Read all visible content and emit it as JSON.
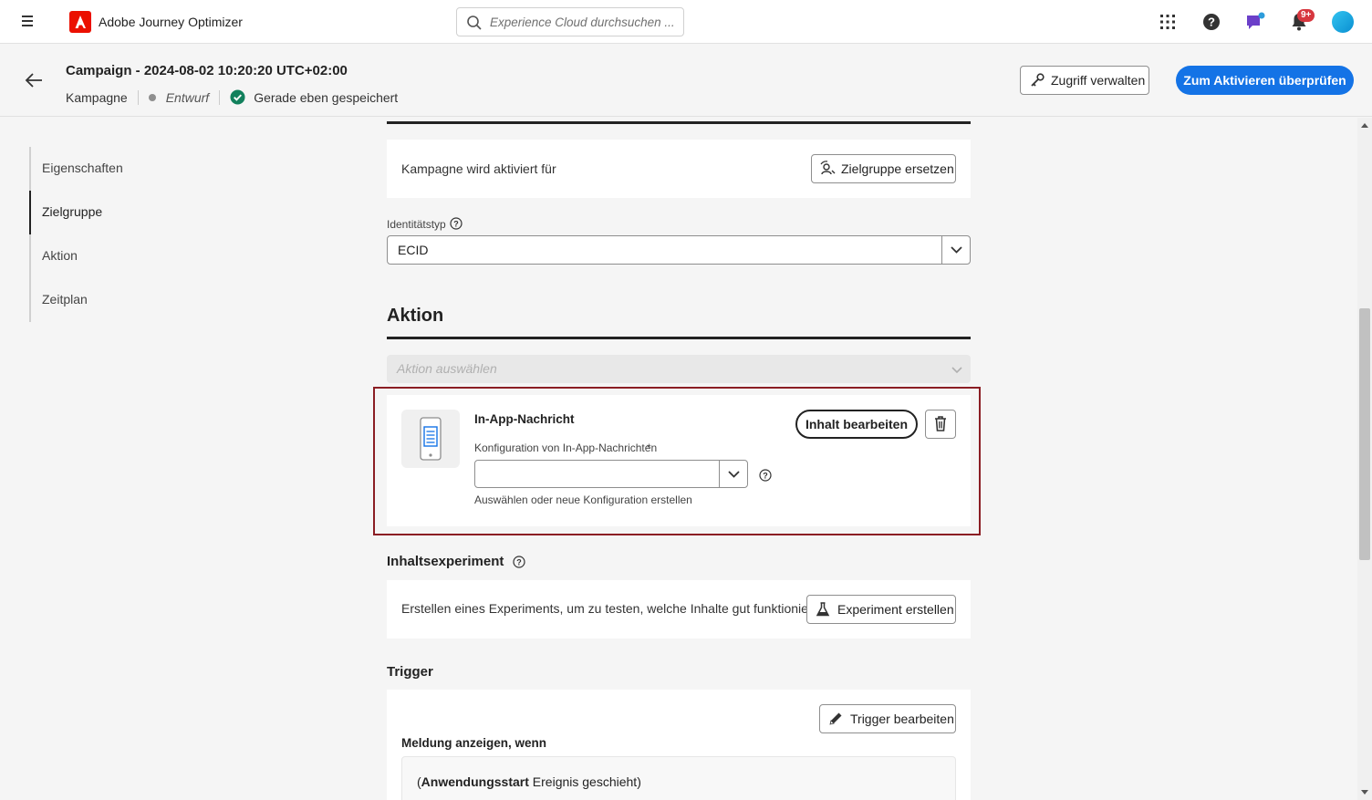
{
  "topnav": {
    "app_title": "Adobe Journey Optimizer",
    "search_placeholder": "Experience Cloud durchsuchen ...",
    "notification_count": "9+"
  },
  "header": {
    "title": "Campaign - 2024-08-02 10:20:20 UTC+02:00",
    "type": "Kampagne",
    "status": "Entwurf",
    "saved": "Gerade eben gespeichert",
    "manage_access": "Zugriff verwalten",
    "review_activate": "Zum Aktivieren überprüfen"
  },
  "leftnav": {
    "items": [
      {
        "label": "Eigenschaften"
      },
      {
        "label": "Zielgruppe"
      },
      {
        "label": "Aktion"
      },
      {
        "label": "Zeitplan"
      }
    ]
  },
  "audience": {
    "activated_for": "Kampagne wird aktiviert für",
    "replace_audience": "Zielgruppe ersetzen",
    "identity_label": "Identitätstyp",
    "identity_value": "ECID"
  },
  "action": {
    "title": "Aktion",
    "select_placeholder": "Aktion auswählen",
    "channel_name": "In-App-Nachricht",
    "config_label": "Konfiguration von In-App-Nachrichten",
    "config_required": "*",
    "config_hint": "Auswählen oder neue Konfiguration erstellen",
    "edit_content": "Inhalt bearbeiten"
  },
  "experiment": {
    "title": "Inhaltsexperiment",
    "description": "Erstellen eines Experiments, um zu testen, welche Inhalte gut funktionieren.",
    "create_button": "Experiment erstellen"
  },
  "trigger": {
    "title": "Trigger",
    "edit_button": "Trigger bearbeiten",
    "show_when": "Meldung anzeigen, wenn",
    "condition_open": "(",
    "condition_bold": "Anwendungsstart",
    "condition_rest": " Ereignis geschieht)"
  },
  "colors": {
    "accent": "#1473e6",
    "highlight_border": "#8b1e24",
    "adobe_red": "#eb1000"
  }
}
